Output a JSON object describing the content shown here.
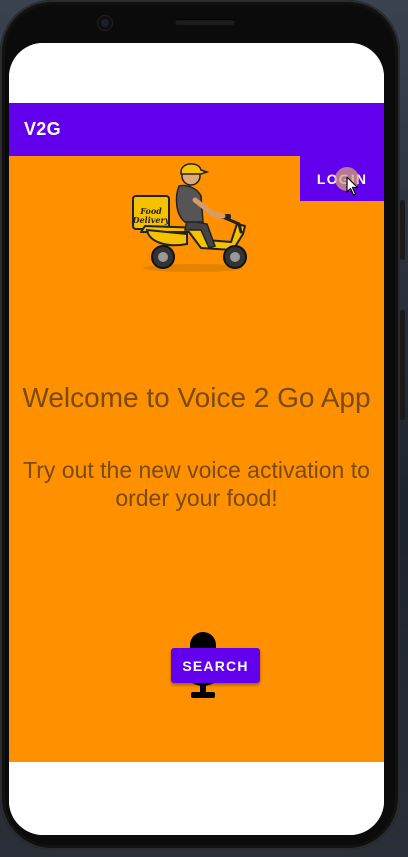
{
  "app": {
    "title": "V2G"
  },
  "toolbar": {
    "login_label": "LOGIN"
  },
  "main": {
    "welcome": "Welcome to Voice 2 Go App",
    "subtitle": "Try out the new voice activation to order your food!",
    "illustration_sign": [
      "Food",
      "Delivery"
    ],
    "search_label": "SEARCH"
  },
  "icons": {
    "illustration": "delivery-scooter-icon",
    "mic": "microphone-icon",
    "cursor": "mouse-pointer-icon"
  },
  "colors": {
    "primary": "#6200ee",
    "background": "#ff9100",
    "text": "#7a4a14"
  }
}
